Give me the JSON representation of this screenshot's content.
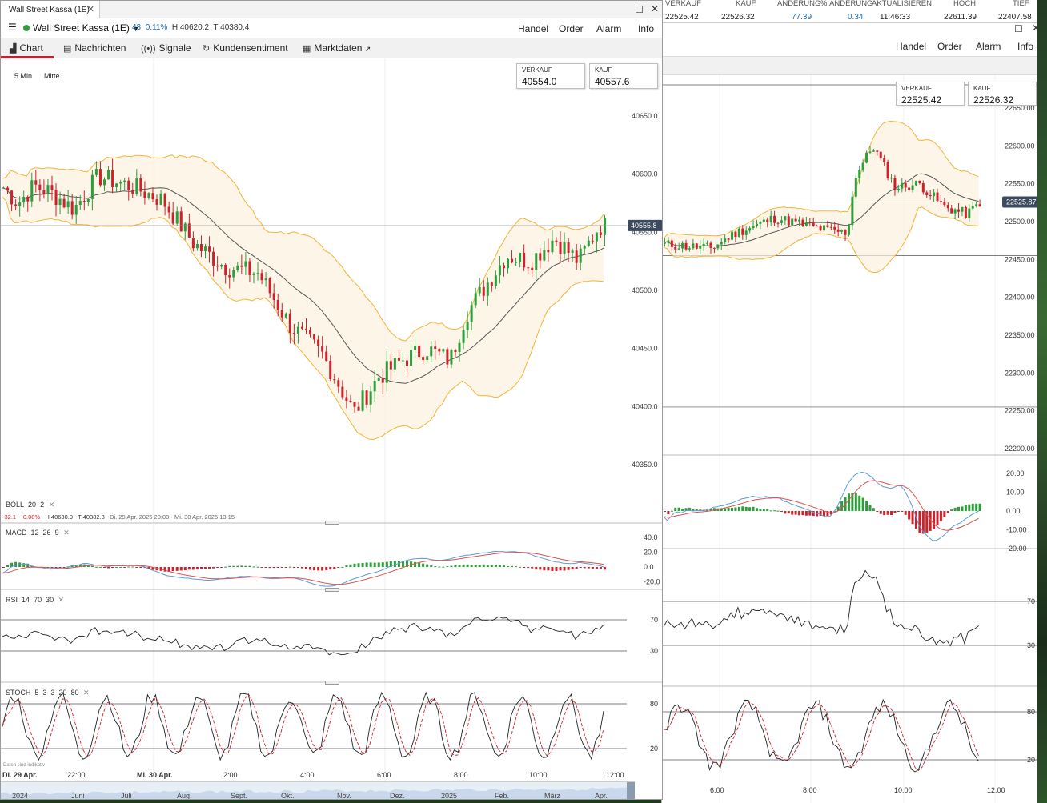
{
  "background_window": {
    "ticker_headers": [
      "VERKAUF",
      "KAUF",
      "ÄNDERUNG",
      "% ÄNDERUNG",
      "AKTUALISIEREN",
      "HOCH",
      "TIEF"
    ],
    "ticker_values": [
      "22525.42",
      "22526.32",
      "77.39",
      "0.34",
      "11:46:33",
      "22611.39",
      "22407.58"
    ],
    "menu": [
      "Handel",
      "Order",
      "Alarm",
      "Info"
    ],
    "sell_label": "VERKAUF",
    "sell_value": "22525.42",
    "buy_label": "KAUF",
    "buy_value": "22526.32",
    "price_tag": "22525.87",
    "price_axis": [
      "22650.00",
      "22600.00",
      "22550.00",
      "22500.00",
      "22450.00",
      "22400.00",
      "22350.00",
      "22300.00",
      "22250.00",
      "22200.00"
    ],
    "macd_axis": [
      "20.00",
      "10.00",
      "0.00",
      "-10.00",
      "-20.00"
    ],
    "rsi_axis": [
      "70",
      "30"
    ],
    "stoch_axis": [
      "80",
      "20"
    ],
    "time_axis": [
      "6:00",
      "8:00",
      "10:00",
      "12:00"
    ]
  },
  "main_window": {
    "tab_title": "Wall Street Kassa (1E)",
    "instrument": "Wall Street Kassa (1E)",
    "stats": {
      "change": "43",
      "change_pct": "0.11%",
      "high": "H 40620.2",
      "low": "T 40380.4"
    },
    "menu": [
      "Handel",
      "Order",
      "Alarm",
      "Info"
    ],
    "tabs": [
      "Chart",
      "Nachrichten",
      "Signale",
      "Kundensentiment",
      "Marktdaten"
    ],
    "interval": "5 Min",
    "price_type": "Mitte",
    "sell_label": "VERKAUF",
    "sell_value": "40554.0",
    "buy_label": "KAUF",
    "buy_value": "40557.6",
    "price_tag": "40555.8",
    "price_axis": [
      "40650.0",
      "40600.0",
      "40550.0",
      "40500.0",
      "40450.0",
      "40400.0",
      "40350.0"
    ],
    "boll": {
      "name": "BOLL",
      "p1": "20",
      "p2": "2"
    },
    "status_line": {
      "chg": "-32.1",
      "chg_pct": "-0.08%",
      "high": "H 40630.9",
      "low": "T 40382.8",
      "range": "Di. 29 Apr. 2025 20:00 - Mi. 30 Apr. 2025 13:15"
    },
    "macd": {
      "name": "MACD",
      "p1": "12",
      "p2": "26",
      "p3": "9",
      "axis": [
        "40.0",
        "20.0",
        "0.0",
        "-20.0"
      ]
    },
    "rsi": {
      "name": "RSI",
      "p1": "14",
      "p2": "70",
      "p3": "30",
      "axis": [
        "70",
        "30"
      ]
    },
    "stoch": {
      "name": "STOCH",
      "p1": "5",
      "p2": "3",
      "p3": "3",
      "p4": "20",
      "p5": "80",
      "axis": [
        "80",
        "20"
      ]
    },
    "disclaimer": "Daten sind indikativ",
    "time_axis": [
      "Di. 29 Apr.",
      "22:00",
      "Mi. 30 Apr.",
      "2:00",
      "4:00",
      "6:00",
      "8:00",
      "10:00",
      "12:00"
    ],
    "scroll_labels": [
      "2024",
      "Juni",
      "Juli",
      "Aug.",
      "Sept.",
      "Okt.",
      "Nov.",
      "Dez.",
      "2025",
      "Feb.",
      "März",
      "Apr."
    ]
  },
  "colors": {
    "up": "#2e9d3b",
    "down": "#d0202a",
    "boll_band": "#f5b335",
    "ma": "#555555",
    "accent": "#c8202f",
    "macd_line": "#5b9bd5",
    "signal_line": "#d9534f"
  },
  "icons": [
    "hamburger-icon",
    "chart-icon",
    "news-icon",
    "signal-icon",
    "sentiment-icon",
    "marketdata-icon",
    "external-link-icon",
    "close-icon",
    "maximize-icon",
    "dropdown-icon"
  ]
}
